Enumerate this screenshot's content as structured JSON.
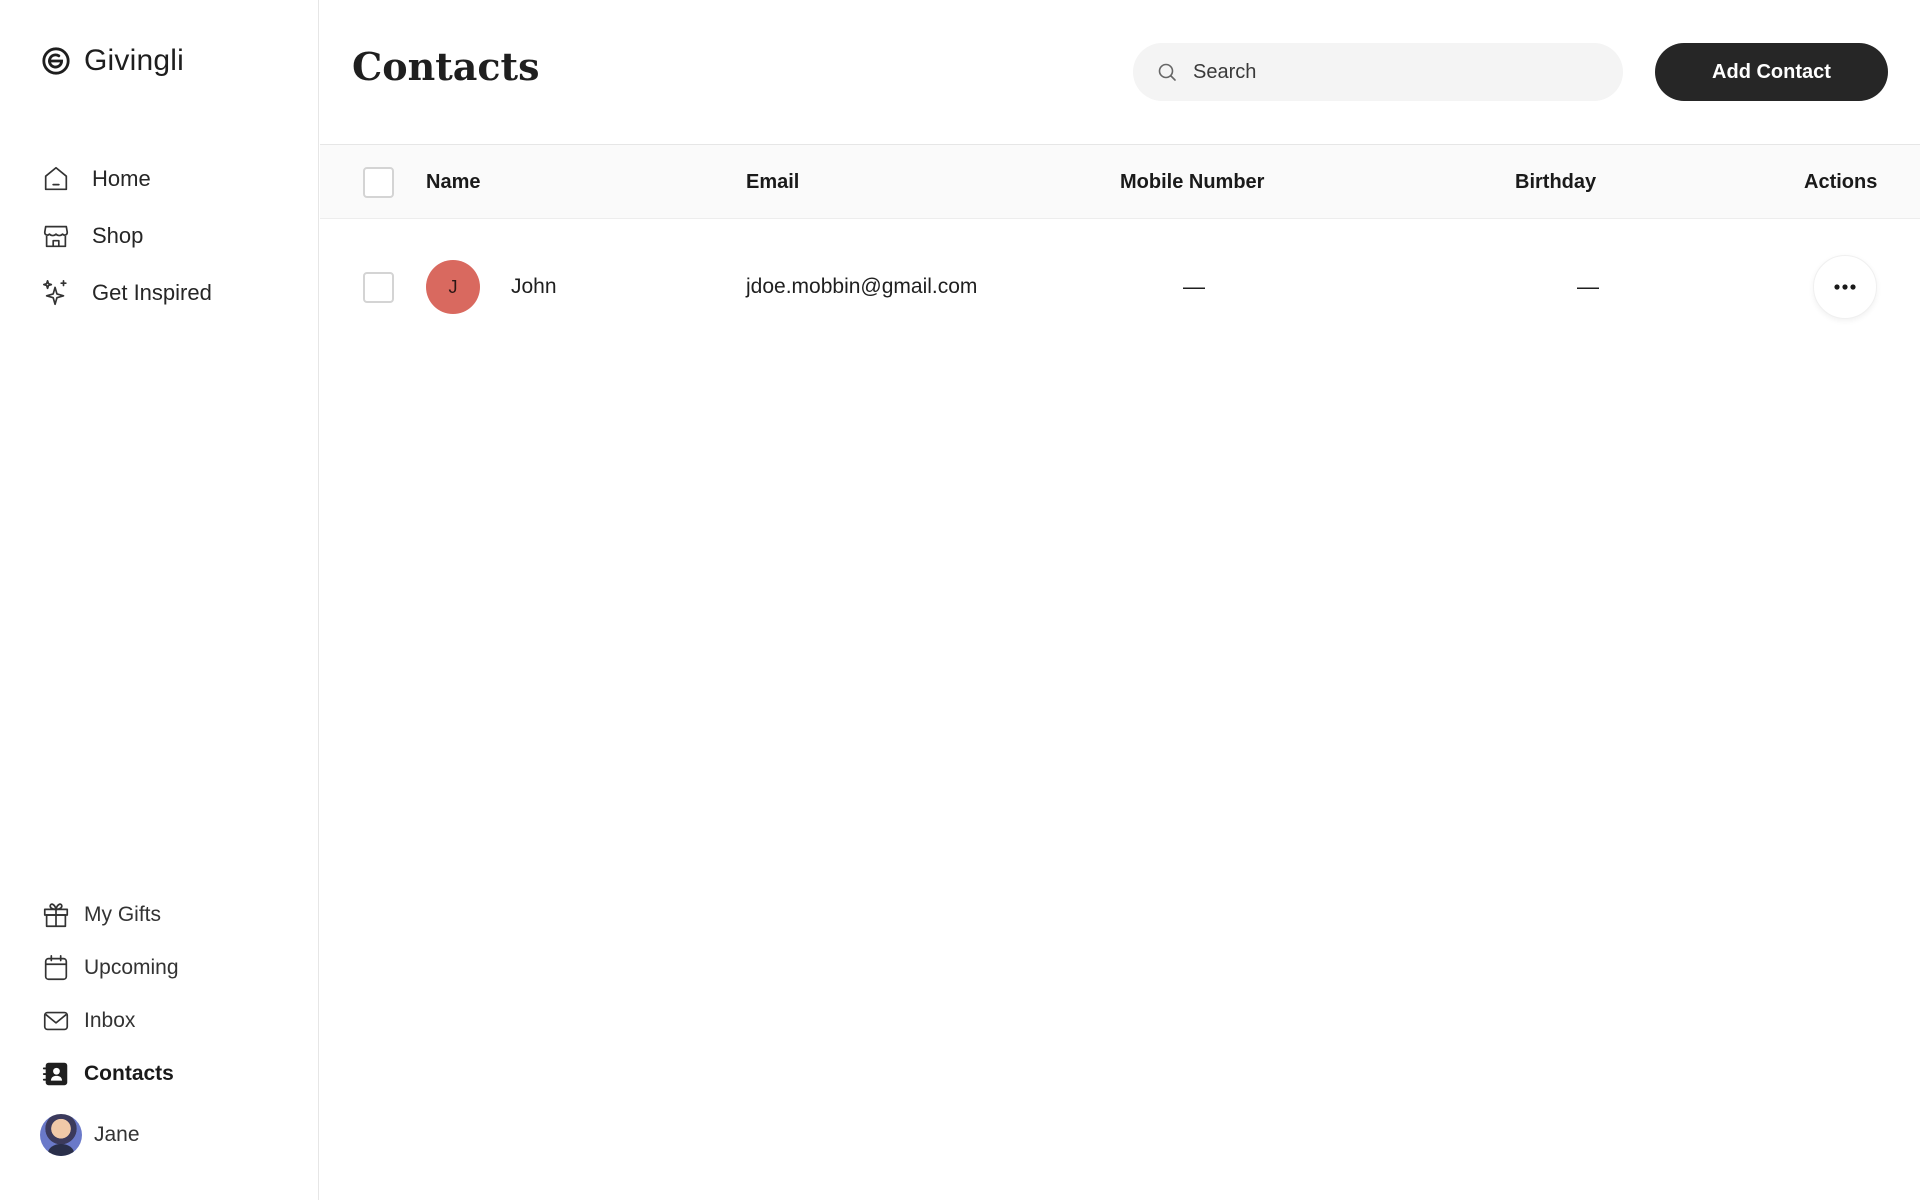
{
  "app": {
    "name": "Givingli"
  },
  "sidebar": {
    "top_items": [
      {
        "label": "Home",
        "icon": "home-icon"
      },
      {
        "label": "Shop",
        "icon": "shop-icon"
      },
      {
        "label": "Get Inspired",
        "icon": "sparkles-icon"
      }
    ],
    "bottom_items": [
      {
        "label": "My Gifts",
        "icon": "gift-icon"
      },
      {
        "label": "Upcoming",
        "icon": "calendar-icon"
      },
      {
        "label": "Inbox",
        "icon": "mail-icon"
      },
      {
        "label": "Contacts",
        "icon": "contacts-icon",
        "active": true
      }
    ],
    "user": {
      "name": "Jane"
    }
  },
  "header": {
    "title": "Contacts",
    "search_placeholder": "Search",
    "add_button_label": "Add Contact"
  },
  "table": {
    "columns": [
      "Name",
      "Email",
      "Mobile Number",
      "Birthday",
      "Actions"
    ],
    "rows": [
      {
        "initial": "J",
        "name": "John",
        "email": "jdoe.mobbin@gmail.com",
        "mobile": "—",
        "birthday": "—",
        "avatar_color": "#d9695f"
      }
    ]
  },
  "colors": {
    "primary_button": "#262626",
    "search_bg": "#f4f4f4",
    "avatar": "#d9695f"
  }
}
